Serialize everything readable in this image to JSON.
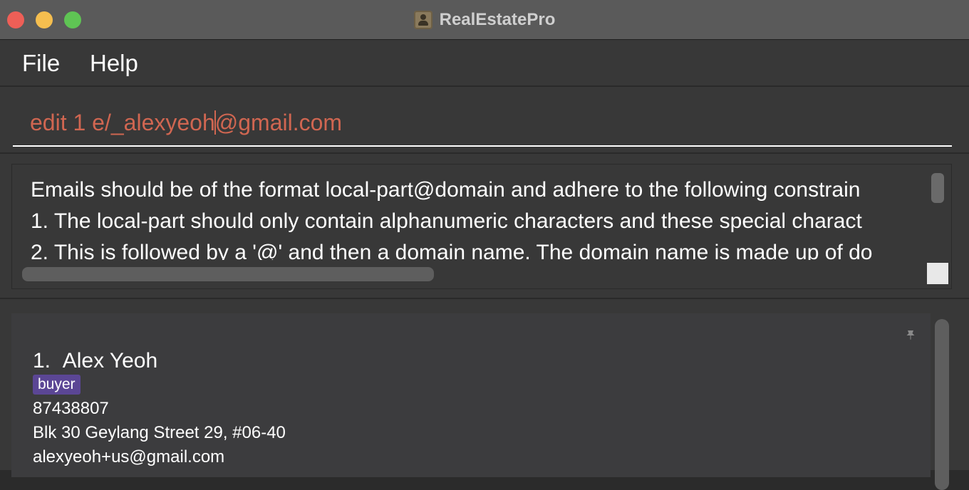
{
  "window": {
    "title": "RealEstatePro"
  },
  "menu": {
    "items": [
      "File",
      "Help"
    ]
  },
  "command": {
    "before_caret": "edit 1 e/_alexyeoh",
    "after_caret": "@gmail.com"
  },
  "result": {
    "lines": [
      "Emails should be of the format local-part@domain and adhere to the following constrain",
      "1. The local-part should only contain alphanumeric characters and these special charact",
      "2. This is followed by a '@' and then a domain name. The domain name is made up of do"
    ]
  },
  "persons": [
    {
      "index": "1.",
      "name": "Alex Yeoh",
      "tag": "buyer",
      "phone": "87438807",
      "address": "Blk 30 Geylang Street 29, #06-40",
      "email": "alexyeoh+us@gmail.com"
    }
  ],
  "colors": {
    "command_text": "#d06651",
    "tag_bg": "#5b4695",
    "background": "#383838"
  },
  "icons": {
    "pin": "pin-icon",
    "app": "contacts-app-icon"
  }
}
